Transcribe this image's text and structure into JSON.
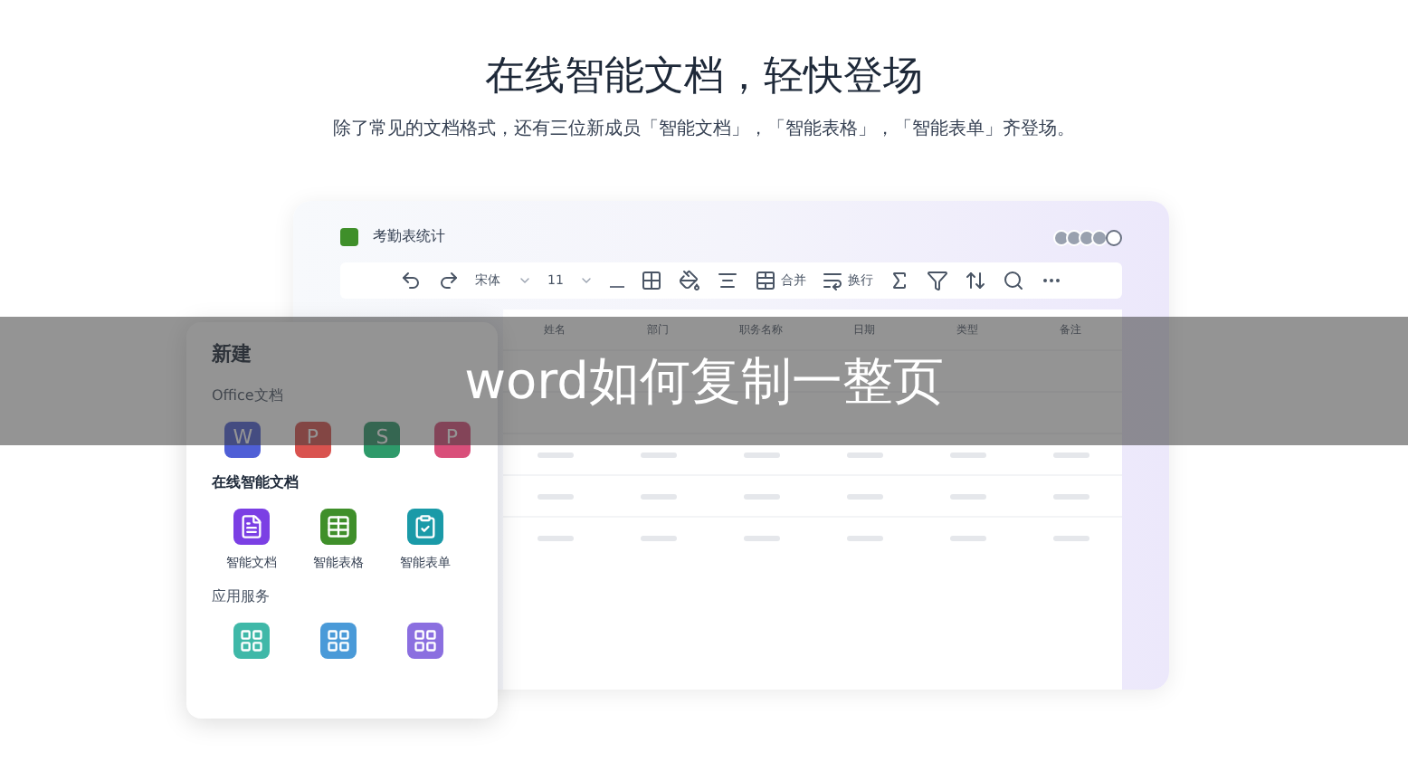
{
  "heading": "在线智能文档，轻快登场",
  "subtitle": "除了常见的文档格式，还有三位新成员「智能文档」，「智能表格」，「智能表单」齐登场。",
  "document": {
    "title": "考勤表统计",
    "toolbar": {
      "font": "宋体",
      "size": "11",
      "merge": "合并",
      "wrap": "换行"
    },
    "columns": [
      "姓名",
      "部门",
      "职务名称",
      "日期",
      "类型",
      "备注"
    ]
  },
  "new_panel": {
    "title": "新建",
    "sections": [
      {
        "title": "Office文档",
        "disabled": true,
        "items": [
          {
            "kind": "letter",
            "letter": "W",
            "color": "#4f5fd6"
          },
          {
            "kind": "letter",
            "letter": "P",
            "color": "#d9534f"
          },
          {
            "kind": "letter",
            "letter": "S",
            "color": "#2e9a6a"
          },
          {
            "kind": "letter",
            "letter": "P",
            "color": "#d94f7a"
          }
        ]
      },
      {
        "title": "在线智能文档",
        "disabled": false,
        "items": [
          {
            "kind": "doc",
            "label": "智能文档",
            "color": "#7b3fe4"
          },
          {
            "kind": "sheet",
            "label": "智能表格",
            "color": "#3f8f2a"
          },
          {
            "kind": "form",
            "label": "智能表单",
            "color": "#1a9aa8"
          }
        ]
      },
      {
        "title": "应用服务",
        "disabled": true,
        "items": [
          {
            "kind": "app",
            "color": "#3fb8a8"
          },
          {
            "kind": "app",
            "color": "#4a9ad8"
          },
          {
            "kind": "app",
            "color": "#8b6fe0"
          }
        ]
      }
    ]
  },
  "caption": "word如何复制一整页"
}
